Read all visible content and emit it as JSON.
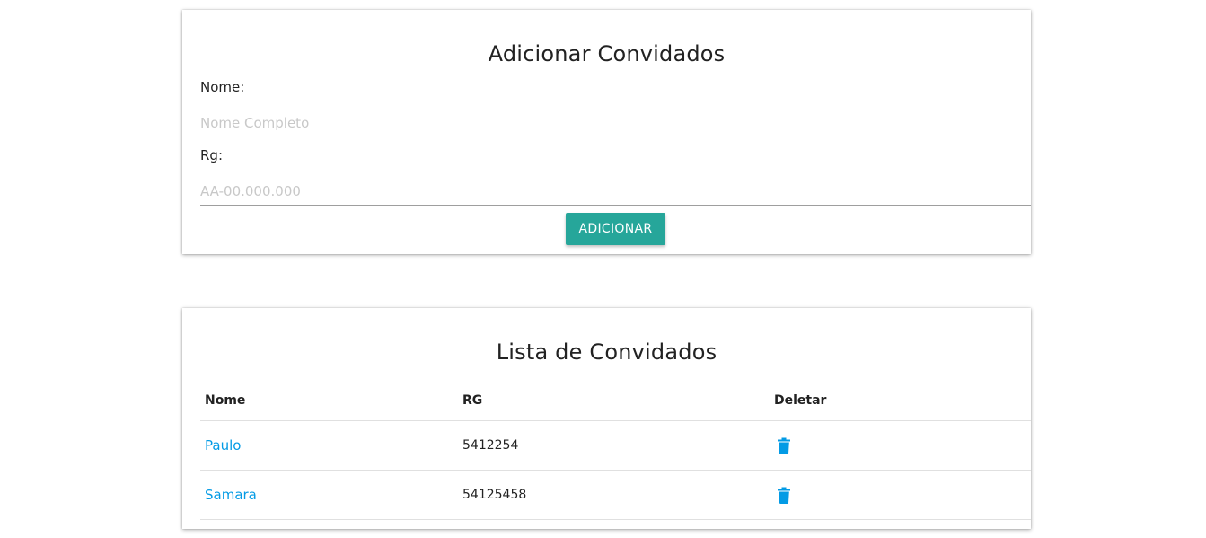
{
  "add_form": {
    "title": "Adicionar Convidados",
    "name_label": "Nome:",
    "name_placeholder": "Nome Completo",
    "name_value": "",
    "rg_label": "Rg:",
    "rg_placeholder": "AA-00.000.000",
    "rg_value": "",
    "submit_label": "ADICIONAR"
  },
  "guest_list": {
    "title": "Lista de Convidados",
    "columns": [
      "Nome",
      "RG",
      "Deletar"
    ],
    "rows": [
      {
        "name": "Paulo",
        "rg": "5412254",
        "delete_icon": "trash-icon"
      },
      {
        "name": "Samara",
        "rg": "54125458",
        "delete_icon": "trash-icon"
      }
    ]
  },
  "colors": {
    "accent": "#26a69a",
    "link": "#039be5"
  }
}
